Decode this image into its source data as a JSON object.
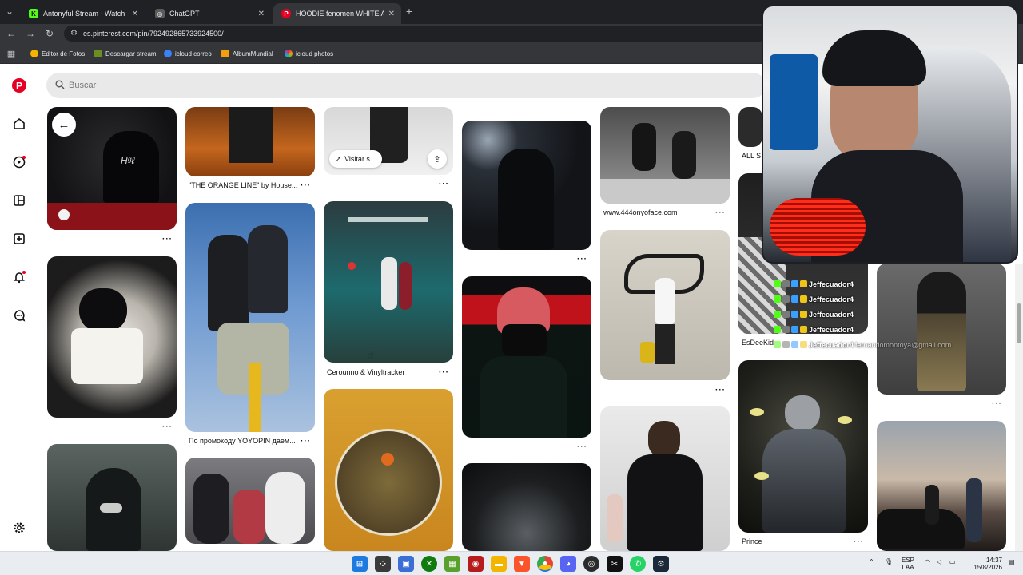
{
  "browser": {
    "tabs": [
      {
        "title": "Antonyful Stream - Watch Live",
        "favicon_color": "#53fc18",
        "favicon_letter": "K",
        "active": false
      },
      {
        "title": "ChatGPT",
        "favicon_color": "#2b2b2b",
        "favicon_letter": "◎",
        "active": false
      },
      {
        "title": "HOODIE fenomen WHITE ALQ",
        "favicon_color": "#e60023",
        "favicon_letter": "P",
        "active": true
      }
    ],
    "new_tab_symbol": "+",
    "url": "es.pinterest.com/pin/792492865733924500/",
    "bookmarks": [
      {
        "label": "Editor de Fotos",
        "color": "#f4b400"
      },
      {
        "label": "Descargar stream",
        "color": "#6b8e23"
      },
      {
        "label": "icloud correo",
        "color": "#3b82f6"
      },
      {
        "label": "AlbumMundial",
        "color": "#f59e0b"
      },
      {
        "label": "icloud photos",
        "color": "#e11d48"
      }
    ]
  },
  "pinterest": {
    "brand_color": "#e60023",
    "search_placeholder": "Buscar",
    "back_symbol": "←",
    "visit_label": "Visitar s...",
    "captions": {
      "orange_line": "\"THE ORANGE LINE\" by House...",
      "yoyopin": "По промокоду YOYOPIN даем...",
      "cerounno": "Cerounno & Vinyltracker",
      "onyoface": "www.444onyoface.com",
      "esdee": "EsDeeKid",
      "all_s": "ALL S",
      "prince": "Prince"
    },
    "more_symbol": "···"
  },
  "stream_chat": {
    "messages": [
      {
        "user": "Jeffecuador4",
        "text": ""
      },
      {
        "user": "Jeffecuador4",
        "text": ""
      },
      {
        "user": "Jeffecuador4",
        "text": ""
      },
      {
        "user": "Jeffecuador4",
        "text": ""
      },
      {
        "user": "Jeffecuador4",
        "text": "fernandomontoya@gmail.com"
      }
    ]
  },
  "taskbar": {
    "language": "ESP",
    "language_sub": "LAA",
    "time": "14:37",
    "date": "15/8/2026"
  }
}
